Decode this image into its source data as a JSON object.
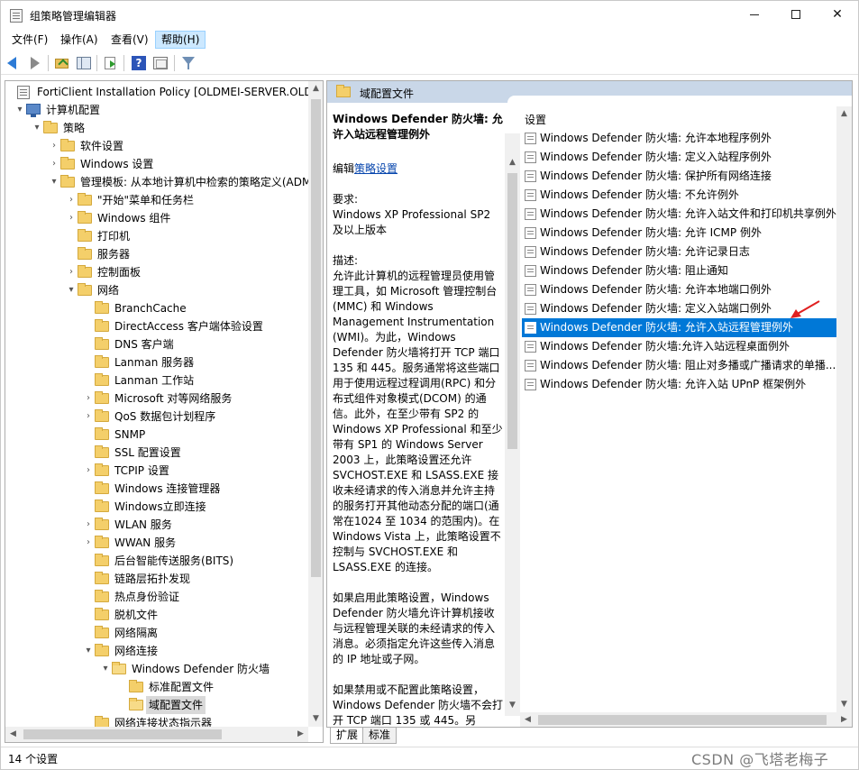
{
  "window": {
    "title": "组策略管理编辑器",
    "controls": {
      "minimize": "",
      "maximize": "",
      "close": "✕"
    }
  },
  "menu": [
    {
      "label": "文件(F)",
      "active": false
    },
    {
      "label": "操作(A)",
      "active": false
    },
    {
      "label": "查看(V)",
      "active": false
    },
    {
      "label": "帮助(H)",
      "active": true
    }
  ],
  "toolbar": {
    "icons": [
      "back-arrow-icon",
      "forward-arrow-icon",
      "up-folder-icon",
      "show-hide-tree-icon",
      "export-list-icon",
      "help-icon",
      "view-icon",
      "filter-icon"
    ],
    "help_glyph": "?"
  },
  "tree": {
    "rows": [
      {
        "label": "FortiClient Installation Policy [OLDMEI-SERVER.OLDMEI.LOCAL] 策略",
        "level": 0,
        "expander": "",
        "icon": "policy",
        "selected": false
      },
      {
        "label": "计算机配置",
        "level": 1,
        "expander": "▾",
        "icon": "computer",
        "selected": false
      },
      {
        "label": "策略",
        "level": 2,
        "expander": "▾",
        "icon": "folder",
        "selected": false
      },
      {
        "label": "软件设置",
        "level": 3,
        "expander": "›",
        "icon": "folder",
        "selected": false
      },
      {
        "label": "Windows 设置",
        "level": 3,
        "expander": "›",
        "icon": "folder",
        "selected": false
      },
      {
        "label": "管理模板: 从本地计算机中检索的策略定义(ADMX 文件)",
        "level": 3,
        "expander": "▾",
        "icon": "folder",
        "selected": false
      },
      {
        "label": "\"开始\"菜单和任务栏",
        "level": 4,
        "expander": "›",
        "icon": "folder",
        "selected": false
      },
      {
        "label": "Windows 组件",
        "level": 4,
        "expander": "›",
        "icon": "folder",
        "selected": false
      },
      {
        "label": "打印机",
        "level": 4,
        "expander": "",
        "icon": "folder",
        "selected": false
      },
      {
        "label": "服务器",
        "level": 4,
        "expander": "",
        "icon": "folder",
        "selected": false
      },
      {
        "label": "控制面板",
        "level": 4,
        "expander": "›",
        "icon": "folder",
        "selected": false
      },
      {
        "label": "网络",
        "level": 4,
        "expander": "▾",
        "icon": "folder",
        "selected": false
      },
      {
        "label": "BranchCache",
        "level": 5,
        "expander": "",
        "icon": "folder",
        "selected": false
      },
      {
        "label": "DirectAccess 客户端体验设置",
        "level": 5,
        "expander": "",
        "icon": "folder",
        "selected": false
      },
      {
        "label": "DNS 客户端",
        "level": 5,
        "expander": "",
        "icon": "folder",
        "selected": false
      },
      {
        "label": "Lanman 服务器",
        "level": 5,
        "expander": "",
        "icon": "folder",
        "selected": false
      },
      {
        "label": "Lanman 工作站",
        "level": 5,
        "expander": "",
        "icon": "folder",
        "selected": false
      },
      {
        "label": "Microsoft 对等网络服务",
        "level": 5,
        "expander": "›",
        "icon": "folder",
        "selected": false
      },
      {
        "label": "QoS 数据包计划程序",
        "level": 5,
        "expander": "›",
        "icon": "folder",
        "selected": false
      },
      {
        "label": "SNMP",
        "level": 5,
        "expander": "",
        "icon": "folder",
        "selected": false
      },
      {
        "label": "SSL 配置设置",
        "level": 5,
        "expander": "",
        "icon": "folder",
        "selected": false
      },
      {
        "label": "TCPIP 设置",
        "level": 5,
        "expander": "›",
        "icon": "folder",
        "selected": false
      },
      {
        "label": "Windows 连接管理器",
        "level": 5,
        "expander": "",
        "icon": "folder",
        "selected": false
      },
      {
        "label": "Windows立即连接",
        "level": 5,
        "expander": "",
        "icon": "folder",
        "selected": false
      },
      {
        "label": "WLAN 服务",
        "level": 5,
        "expander": "›",
        "icon": "folder",
        "selected": false
      },
      {
        "label": "WWAN 服务",
        "level": 5,
        "expander": "›",
        "icon": "folder",
        "selected": false
      },
      {
        "label": "后台智能传送服务(BITS)",
        "level": 5,
        "expander": "",
        "icon": "folder",
        "selected": false
      },
      {
        "label": "链路层拓扑发现",
        "level": 5,
        "expander": "",
        "icon": "folder",
        "selected": false
      },
      {
        "label": "热点身份验证",
        "level": 5,
        "expander": "",
        "icon": "folder",
        "selected": false
      },
      {
        "label": "脱机文件",
        "level": 5,
        "expander": "",
        "icon": "folder",
        "selected": false
      },
      {
        "label": "网络隔离",
        "level": 5,
        "expander": "",
        "icon": "folder",
        "selected": false
      },
      {
        "label": "网络连接",
        "level": 5,
        "expander": "▾",
        "icon": "folder",
        "selected": false
      },
      {
        "label": "Windows Defender 防火墙",
        "level": 6,
        "expander": "▾",
        "icon": "folder-open",
        "selected": false
      },
      {
        "label": "标准配置文件",
        "level": 7,
        "expander": "",
        "icon": "folder",
        "selected": false
      },
      {
        "label": "域配置文件",
        "level": 7,
        "expander": "",
        "icon": "folder-open",
        "selected": true
      },
      {
        "label": "网络连接状态指示器",
        "level": 5,
        "expander": "",
        "icon": "folder",
        "selected": false
      }
    ]
  },
  "details": {
    "header_title": "域配置文件",
    "policy_title": "Windows Defender 防火墙: 允许入站远程管理例外",
    "edit_prefix": "编辑",
    "edit_link": "策略设置",
    "requirements_label": "要求:",
    "requirements_text": "Windows XP Professional SP2 及以上版本",
    "description_label": "描述:",
    "description_text": "允许此计算机的远程管理员使用管理工具，如 Microsoft 管理控制台(MMC) 和 Windows Management Instrumentation (WMI)。为此，Windows Defender 防火墙将打开 TCP 端口 135 和 445。服务通常将这些端口用于使用远程过程调用(RPC) 和分布式组件对象模式(DCOM) 的通信。此外，在至少带有 SP2 的 Windows XP Professional 和至少带有 SP1 的 Windows Server 2003 上，此策略设置还允许 SVCHOST.EXE 和 LSASS.EXE 接收未经请求的传入消息并允许主持的服务打开其他动态分配的端口(通常在1024 至 1034 的范围内)。在 Windows Vista 上，此策略设置不控制与 SVCHOST.EXE 和 LSASS.EXE 的连接。",
    "enabled_text": "如果启用此策略设置，Windows Defender 防火墙允许计算机接收与远程管理关联的未经请求的传入消息。必须指定允许这些传入消息的 IP 地址或子网。",
    "disabled_text": "如果禁用或不配置此策略设置，Windows Defender 防火墙不会打开 TCP 端口 135 或 445。另"
  },
  "settings": {
    "header": "设置",
    "items": [
      {
        "label": "Windows Defender 防火墙: 允许本地程序例外",
        "selected": false
      },
      {
        "label": "Windows Defender 防火墙: 定义入站程序例外",
        "selected": false
      },
      {
        "label": "Windows Defender 防火墙: 保护所有网络连接",
        "selected": false
      },
      {
        "label": "Windows Defender 防火墙: 不允许例外",
        "selected": false
      },
      {
        "label": "Windows Defender 防火墙: 允许入站文件和打印机共享例外",
        "selected": false
      },
      {
        "label": "Windows Defender 防火墙: 允许 ICMP 例外",
        "selected": false
      },
      {
        "label": "Windows Defender 防火墙: 允许记录日志",
        "selected": false
      },
      {
        "label": "Windows Defender 防火墙: 阻止通知",
        "selected": false
      },
      {
        "label": "Windows Defender 防火墙: 允许本地端口例外",
        "selected": false
      },
      {
        "label": "Windows Defender 防火墙: 定义入站端口例外",
        "selected": false
      },
      {
        "label": "Windows Defender 防火墙: 允许入站远程管理例外",
        "selected": true
      },
      {
        "label": "Windows Defender 防火墙:允许入站远程桌面例外",
        "selected": false
      },
      {
        "label": "Windows Defender 防火墙: 阻止对多播或广播请求的单播...",
        "selected": false
      },
      {
        "label": "Windows Defender 防火墙: 允许入站 UPnP 框架例外",
        "selected": false
      }
    ]
  },
  "bottom_tabs": [
    {
      "label": "扩展",
      "active": true
    },
    {
      "label": "标准",
      "active": false
    }
  ],
  "status": {
    "text": "14 个设置",
    "watermark": "CSDN @飞塔老梅子"
  },
  "scroll_arrows": {
    "up": "▲",
    "down": "▼",
    "left": "◀",
    "right": "▶"
  },
  "colors": {
    "selection": "#0078d7",
    "header_band": "#c9d7e8",
    "menu_active": "#cce8ff",
    "annotation_arrow": "#e02020"
  }
}
